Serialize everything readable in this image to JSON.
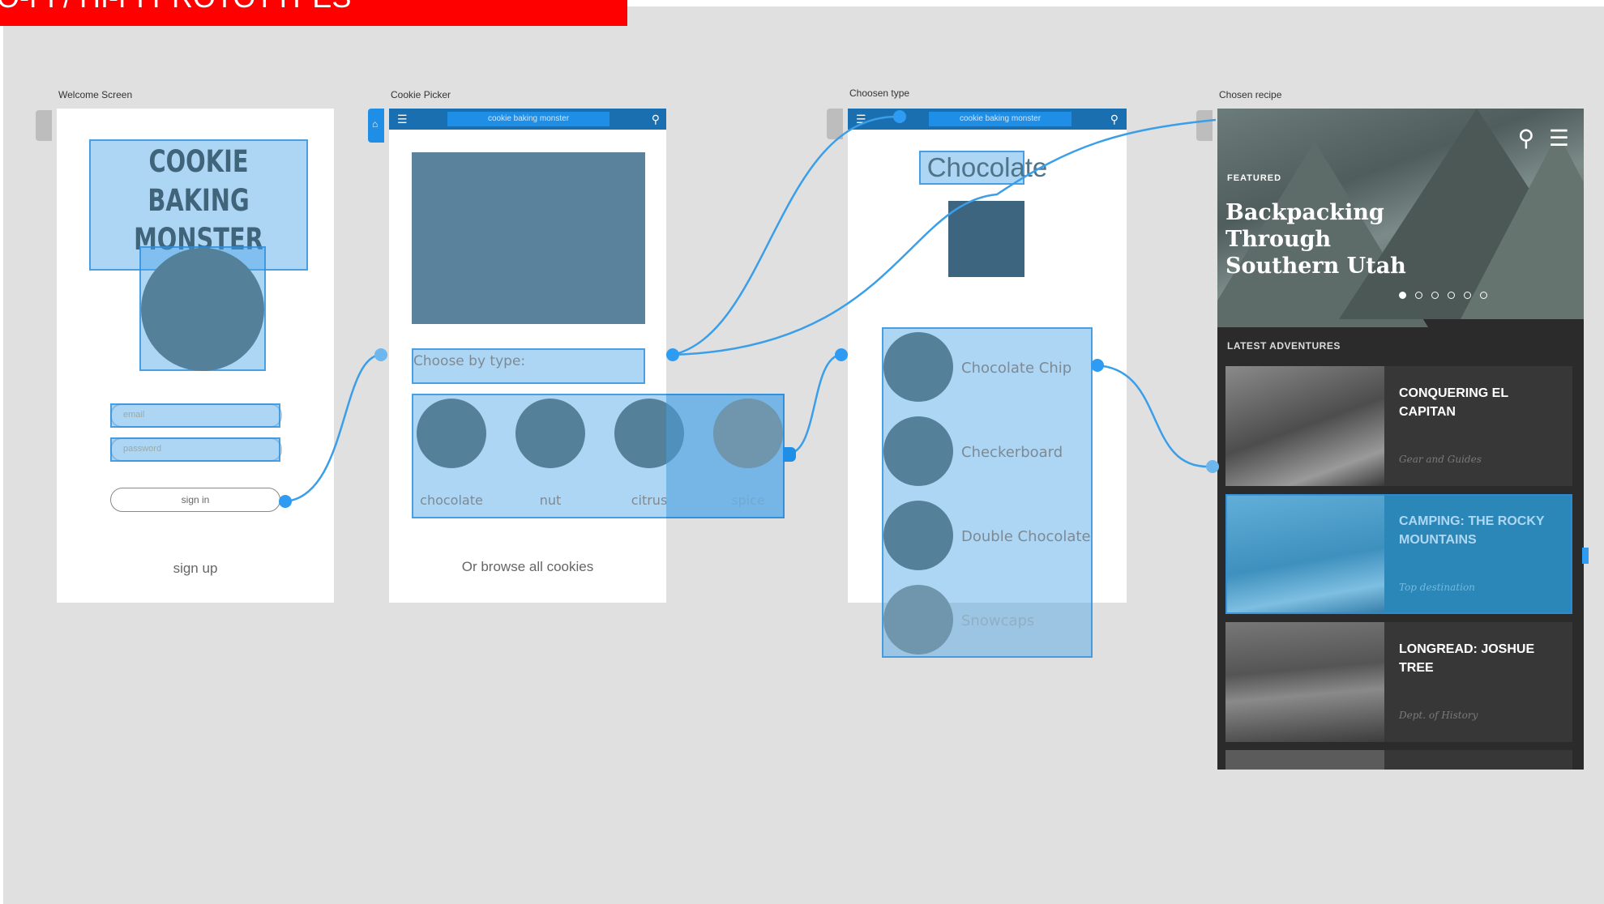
{
  "banner": {
    "text": "O-FI / HI-FI PROTOTYPES"
  },
  "artboards": {
    "welcome": {
      "label": "Welcome Screen",
      "title": "COOKIE BAKING MONSTER",
      "email_placeholder": "email",
      "password_placeholder": "password",
      "signin_label": "sign in",
      "signup_label": "sign up"
    },
    "picker": {
      "label": "Cookie Picker",
      "nav_title": "cookie baking monster",
      "choose_label": "Choose by type:",
      "types": [
        "chocolate",
        "nut",
        "citrus",
        "spice"
      ],
      "browse_label": "Or browse all cookies"
    },
    "chosen_type": {
      "label": "Choosen type",
      "nav_title": "cookie baking monster",
      "heading": "Chocolate",
      "items": [
        "Chocolate Chip",
        "Checkerboard",
        "Double Chocolate",
        "Snowcaps"
      ]
    },
    "recipe": {
      "label": "Chosen recipe",
      "featured": "FEATURED",
      "hero_title": "Backpacking Through Southern Utah",
      "latest": "LATEST ADVENTURES",
      "cards": [
        {
          "title": "CONQUERING EL CAPITAN",
          "subtitle": "Gear and Guides"
        },
        {
          "title": "CAMPING: THE ROCKY MOUNTAINS",
          "subtitle": "Top destination"
        },
        {
          "title": "LONGREAD: JOSHUE TREE",
          "subtitle": "Dept. of History"
        }
      ]
    }
  },
  "colors": {
    "accent": "#2d9cf2",
    "highlight": "#4aa3e8",
    "banner": "#ff0000",
    "canvas": "#e0e0e0"
  }
}
